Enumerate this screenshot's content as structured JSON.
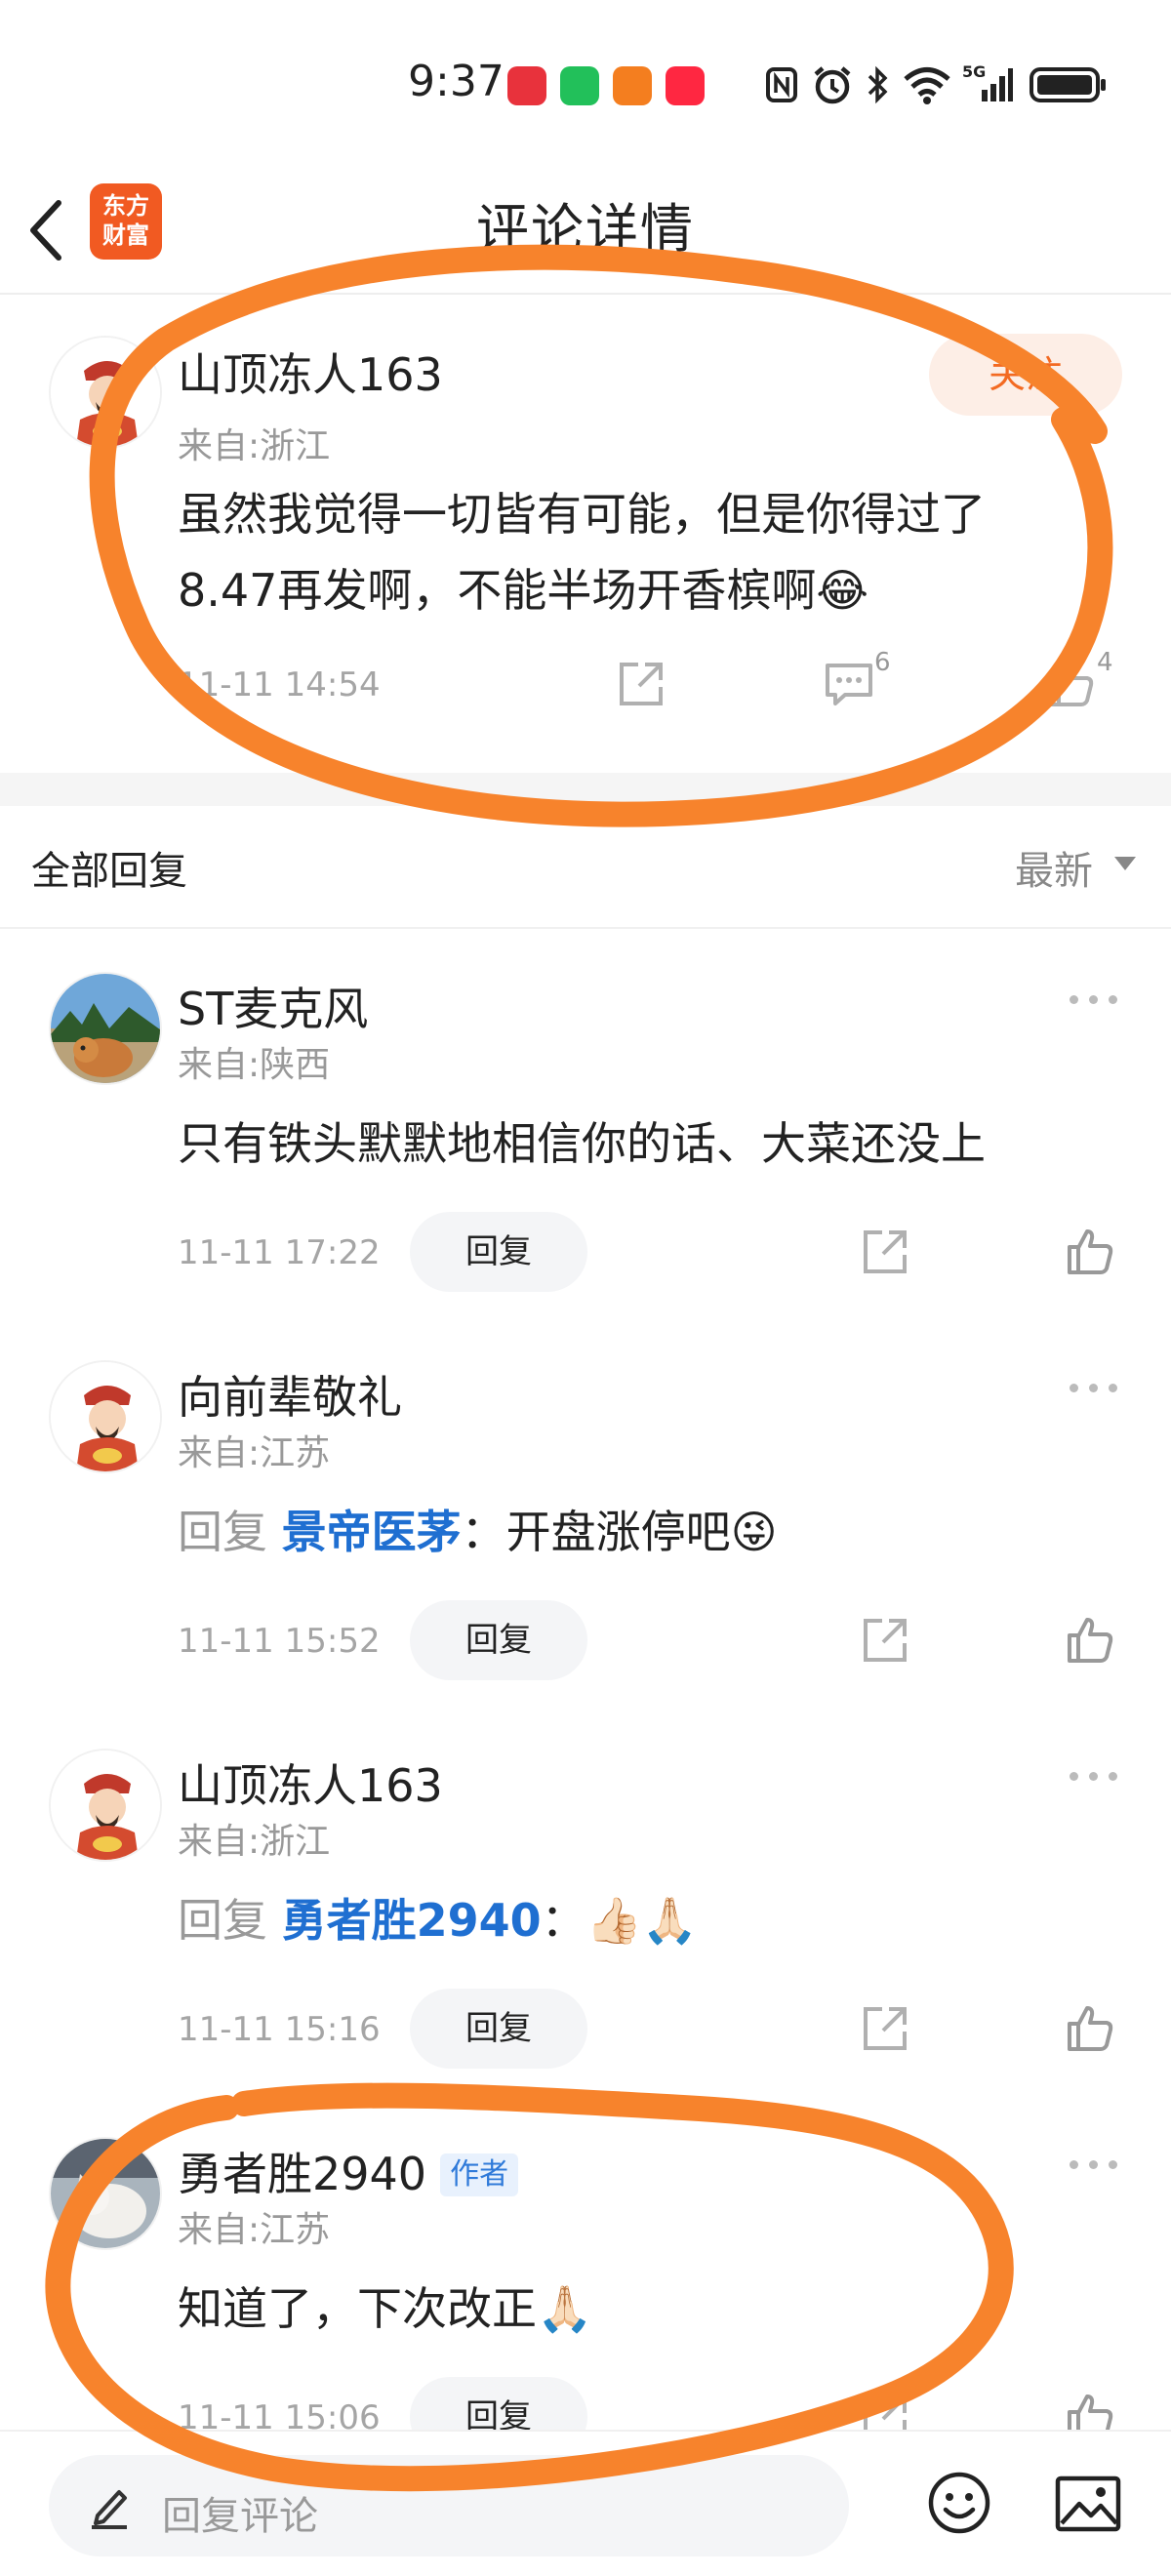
{
  "status_bar": {
    "time": "9:37",
    "network": "5G",
    "icons": [
      "app-red-icon",
      "wechat-icon",
      "app-orange-icon",
      "xiaohongshu-icon",
      "nfc-icon",
      "alarm-icon",
      "bluetooth-icon",
      "wifi-icon",
      "signal-icon",
      "battery-icon"
    ]
  },
  "nav": {
    "logo_line1": "东方",
    "logo_line2": "财富",
    "title": "评论详情"
  },
  "main_comment": {
    "username": "山顶冻人163",
    "location": "来自:浙江",
    "follow_label": "关注",
    "text": "虽然我觉得一切皆有可能，但是你得过了8.47再发啊，不能半场开香槟啊😂",
    "timestamp": "11-11 14:54",
    "comment_count": "6",
    "like_count": "4"
  },
  "replies_header": {
    "title": "全部回复",
    "sort_label": "最新"
  },
  "replies": [
    {
      "username": "ST麦克风",
      "location": "来自:陕西",
      "prefix": "",
      "mention": "",
      "separator": "",
      "text": "只有铁头默默地相信你的话、大菜还没上",
      "timestamp": "11-11 17:22",
      "reply_label": "回复"
    },
    {
      "username": "向前辈敬礼",
      "location": "来自:江苏",
      "prefix": "回复 ",
      "mention": "景帝医茅",
      "separator": "：",
      "text": "开盘涨停吧😜",
      "timestamp": "11-11 15:52",
      "reply_label": "回复"
    },
    {
      "username": "山顶冻人163",
      "location": "来自:浙江",
      "prefix": "回复 ",
      "mention": "勇者胜2940",
      "separator": "：",
      "text": "👍🏻🙏🏻",
      "timestamp": "11-11 15:16",
      "reply_label": "回复"
    },
    {
      "username": "勇者胜2940",
      "badge": "作者",
      "location": "来自:江苏",
      "prefix": "",
      "mention": "",
      "separator": "",
      "text": "知道了，下次改正🙏🏻",
      "timestamp": "11-11 15:06",
      "reply_label": "回复"
    }
  ],
  "bottom_bar": {
    "input_placeholder": "回复评论"
  },
  "colors": {
    "accent": "#f36a22",
    "mention": "#1f6fd1",
    "annotation": "#f7832c"
  }
}
